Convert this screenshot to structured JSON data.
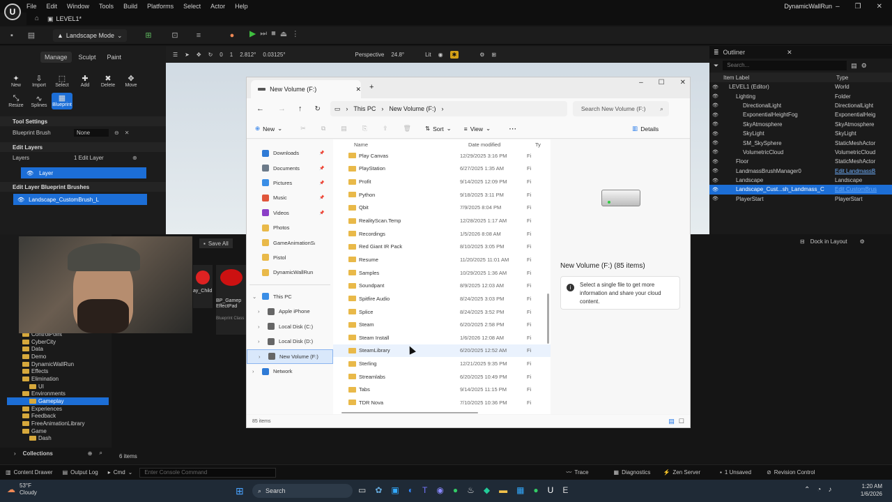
{
  "app": {
    "project_name": "DynamicWallRun",
    "level_tab": "LEVEL1*",
    "menu": [
      "File",
      "Edit",
      "Window",
      "Tools",
      "Build",
      "Platforms",
      "Select",
      "Actor",
      "Help"
    ],
    "mode_button": "Landscape Mode"
  },
  "viewport": {
    "perspective": "Perspective",
    "fov": "24.8°",
    "lit": "Lit",
    "grid": "0",
    "snap_scale": "2.812°",
    "snap_scale2": "0.03125°",
    "cam_speed": "1"
  },
  "landscape": {
    "tabs": [
      "Manage",
      "Sculpt",
      "Paint"
    ],
    "tools_row1": [
      "New",
      "Import",
      "Select",
      "Add",
      "Delete",
      "Move"
    ],
    "tools_row2": [
      "Resize",
      "Splines",
      "Blueprint"
    ],
    "tool_settings": "Tool Settings",
    "blueprint_brush_label": "Blueprint Brush",
    "blueprint_brush_value": "None",
    "edit_layers": "Edit Layers",
    "layers_label": "Layers",
    "layers_count": "1 Edit Layer",
    "layer_name": "Layer",
    "bp_brushes": "Edit Layer Blueprint Brushes",
    "brush_name": "Landscape_CustomBrush_L"
  },
  "outliner": {
    "title": "Outliner",
    "search_placeholder": "Search...",
    "col_label": "Item Label",
    "col_type": "Type",
    "rows": [
      {
        "label": "LEVEL1 (Editor)",
        "type": "World",
        "indent": 1
      },
      {
        "label": "Lighting",
        "type": "Folder",
        "indent": 2
      },
      {
        "label": "DirectionalLight",
        "type": "DirectionalLight",
        "indent": 3
      },
      {
        "label": "ExponentialHeightFog",
        "type": "ExponentialHeig",
        "indent": 3
      },
      {
        "label": "SkyAtmosphere",
        "type": "SkyAtmosphere",
        "indent": 3
      },
      {
        "label": "SkyLight",
        "type": "SkyLight",
        "indent": 3
      },
      {
        "label": "SM_SkySphere",
        "type": "StaticMeshActor",
        "indent": 3
      },
      {
        "label": "VolumetricCloud",
        "type": "VolumetricCloud",
        "indent": 3
      },
      {
        "label": "Floor",
        "type": "StaticMeshActor",
        "indent": 2
      },
      {
        "label": "LandmassBrushManager0",
        "type": "Edit LandmassB",
        "indent": 2
      },
      {
        "label": "Landscape",
        "type": "Landscape",
        "indent": 2
      },
      {
        "label": "Landscape_Cust...sh_Landmass_C",
        "type": "Edit CustomBrus",
        "indent": 2
      },
      {
        "label": "PlayerStart",
        "type": "PlayerStart",
        "indent": 2
      }
    ]
  },
  "content_browser": {
    "save_all": "Save All",
    "dock_in_layout": "Dock in Layout",
    "items_count": "6 items",
    "collections": "Collections",
    "tree": [
      "ControlPoint",
      "CyberCity",
      "Data",
      "Demo",
      "DynamicWallRun",
      "Effects",
      "Elimination",
      "UI",
      "Environments",
      "Gameplay",
      "Experiences",
      "Feedback",
      "FreeAnimationLibrary",
      "Game",
      "Dash"
    ],
    "asset_thumbs": [
      {
        "name": "BP_Gamep EffectPad",
        "sub": "Blueprint Class"
      },
      {
        "name": "ay_Child",
        "sub": ""
      }
    ]
  },
  "explorer": {
    "tab_title": "New Volume (F:)",
    "breadcrumb": [
      "This PC",
      "New Volume (F:)"
    ],
    "search_placeholder": "Search New Volume (F:)",
    "new_label": "New",
    "sort_label": "Sort",
    "view_label": "View",
    "details_label": "Details",
    "col_name": "Name",
    "col_date": "Date modified",
    "col_type": "Ty",
    "nav_items": [
      {
        "label": "Downloads",
        "icon": "#2f7bd6",
        "pin": true
      },
      {
        "label": "Documents",
        "icon": "#6c7a89",
        "pin": true
      },
      {
        "label": "Pictures",
        "icon": "#3a8ee6",
        "pin": true
      },
      {
        "label": "Music",
        "icon": "#e0563b",
        "pin": true
      },
      {
        "label": "Videos",
        "icon": "#8b3fc7",
        "pin": true
      },
      {
        "label": "Photos",
        "icon": "#e9b949",
        "pin": false
      },
      {
        "label": "GameAnimationSample",
        "icon": "#e9b949",
        "pin": false
      },
      {
        "label": "Pistol",
        "icon": "#e9b949",
        "pin": false
      },
      {
        "label": "DynamicWallRun",
        "icon": "#e9b949",
        "pin": false
      }
    ],
    "tree_items": [
      {
        "label": "This PC",
        "indent": 0,
        "selected": false
      },
      {
        "label": "Apple iPhone",
        "indent": 1,
        "selected": false
      },
      {
        "label": "Local Disk (C:)",
        "indent": 1,
        "selected": false
      },
      {
        "label": "Local Disk (D:)",
        "indent": 1,
        "selected": false
      },
      {
        "label": "New Volume (F:)",
        "indent": 1,
        "selected": true
      },
      {
        "label": "Network",
        "indent": 0,
        "selected": false
      }
    ],
    "files": [
      {
        "name": "Play Canvas",
        "date": "12/29/2025 3:16 PM",
        "type": "Fi"
      },
      {
        "name": "PlayStation",
        "date": "6/27/2025 1:35 AM",
        "type": "Fi"
      },
      {
        "name": "Profit",
        "date": "9/14/2025 12:09 PM",
        "type": "Fi"
      },
      {
        "name": "Python",
        "date": "9/18/2025 3:11 PM",
        "type": "Fi"
      },
      {
        "name": "Qbit",
        "date": "7/9/2025 8:04 PM",
        "type": "Fi"
      },
      {
        "name": "RealityScan.Temp",
        "date": "12/28/2025 1:17 AM",
        "type": "Fi"
      },
      {
        "name": "Recordings",
        "date": "1/5/2026 8:08 AM",
        "type": "Fi"
      },
      {
        "name": "Red Giant IR Pack",
        "date": "8/10/2025 3:05 PM",
        "type": "Fi"
      },
      {
        "name": "Resume",
        "date": "11/20/2025 11:01 AM",
        "type": "Fi"
      },
      {
        "name": "Samples",
        "date": "10/29/2025 1:36 AM",
        "type": "Fi"
      },
      {
        "name": "Soundpant",
        "date": "8/9/2025 12:03 AM",
        "type": "Fi"
      },
      {
        "name": "Spitfire Audio",
        "date": "8/24/2025 3:03 PM",
        "type": "Fi"
      },
      {
        "name": "Splice",
        "date": "8/24/2025 3:52 PM",
        "type": "Fi"
      },
      {
        "name": "Steam",
        "date": "6/20/2025 2:58 PM",
        "type": "Fi"
      },
      {
        "name": "Steam Install",
        "date": "1/6/2026 12:08 AM",
        "type": "Fi"
      },
      {
        "name": "SteamLibrary",
        "date": "6/20/2025 12:52 AM",
        "type": "Fi"
      },
      {
        "name": "Sterling",
        "date": "12/21/2025 9:35 PM",
        "type": "Fi"
      },
      {
        "name": "Streamlabs",
        "date": "6/20/2025 10:49 PM",
        "type": "Fi"
      },
      {
        "name": "Tabs",
        "date": "9/14/2025 11:15 PM",
        "type": "Fi"
      },
      {
        "name": "TDR Nova",
        "date": "7/10/2025 10:36 PM",
        "type": "Fi"
      }
    ],
    "details_title": "New Volume (F:) (85 items)",
    "details_info": "Select a single file to get more information and share your cloud content.",
    "status_items": "85 items"
  },
  "statusbar": {
    "content_drawer": "Content Drawer",
    "output_log": "Output Log",
    "cmd": "Cmd",
    "console_placeholder": "Enter Console Command",
    "trace": "Trace",
    "diagnostics": "Diagnostics",
    "zen_server": "Zen Server",
    "unsaved": "1 Unsaved",
    "revision_control": "Revision Control"
  },
  "taskbar": {
    "weather_temp": "53°F",
    "weather_desc": "Cloudy",
    "search": "Search",
    "time": "1:20 AM",
    "date": "1/6/2026"
  }
}
